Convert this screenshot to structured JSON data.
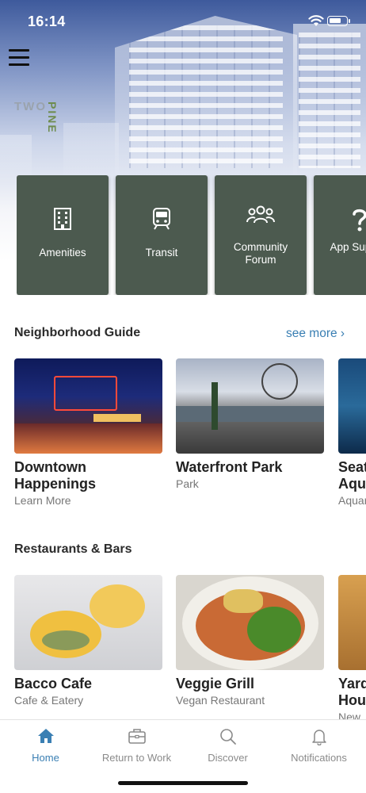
{
  "status_bar": {
    "time": "16:14"
  },
  "brand": {
    "logo_word1": "TWO",
    "logo_word2": "PINE"
  },
  "quick_links": [
    {
      "label": "Amenities",
      "icon": "building-icon"
    },
    {
      "label": "Transit",
      "icon": "train-icon"
    },
    {
      "label": "Community Forum",
      "icon": "people-icon"
    },
    {
      "label": "App Support",
      "icon": "question-icon"
    }
  ],
  "neighborhood_guide": {
    "title": "Neighborhood Guide",
    "see_more": "see more ›",
    "items": [
      {
        "name": "Downtown Happenings",
        "subtitle": "Learn More"
      },
      {
        "name": "Waterfront Park",
        "subtitle": "Park"
      },
      {
        "name": "Seattle Aquarium",
        "subtitle": "Aquarium"
      }
    ]
  },
  "restaurants": {
    "title": "Restaurants & Bars",
    "items": [
      {
        "name": "Bacco Cafe",
        "subtitle": "Cafe & Eatery"
      },
      {
        "name": "Veggie Grill",
        "subtitle": "Vegan Restaurant"
      },
      {
        "name": "Yard House",
        "subtitle": "New American"
      }
    ]
  },
  "tab_bar": {
    "tabs": [
      {
        "label": "Home",
        "icon": "home-icon",
        "active": true
      },
      {
        "label": "Return to Work",
        "icon": "briefcase-icon",
        "active": false
      },
      {
        "label": "Discover",
        "icon": "search-icon",
        "active": false
      },
      {
        "label": "Notifications",
        "icon": "bell-icon",
        "active": false
      }
    ]
  },
  "colors": {
    "tile": "#4c5a4f",
    "accent": "#3a7fb3"
  }
}
